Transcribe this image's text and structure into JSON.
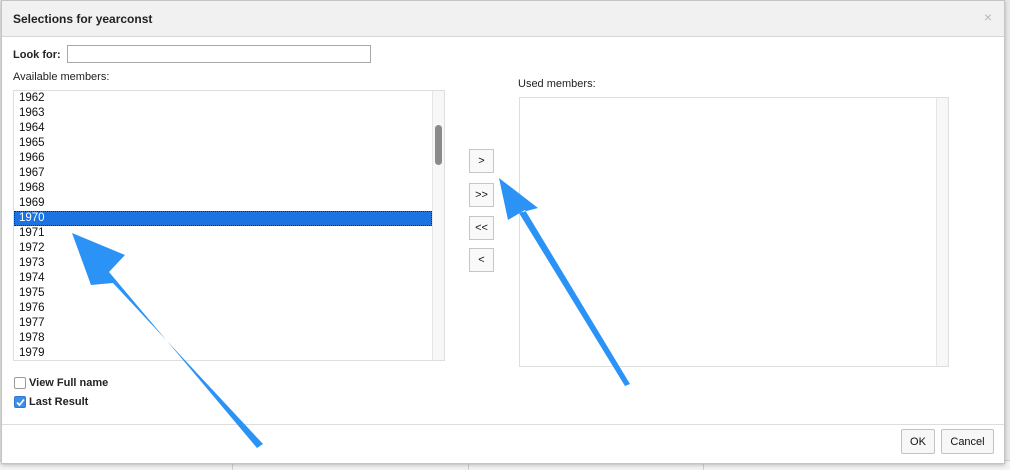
{
  "dialog": {
    "title": "Selections for yearconst",
    "close_glyph": "×",
    "look_for_label": "Look for:",
    "look_for_value": "",
    "available_label": "Available members:",
    "used_label": "Used members:",
    "available_members": [
      "1962",
      "1963",
      "1964",
      "1965",
      "1966",
      "1967",
      "1968",
      "1969",
      "1970",
      "1971",
      "1972",
      "1973",
      "1974",
      "1975",
      "1976",
      "1977",
      "1978",
      "1979"
    ],
    "selected_member": "1970",
    "used_members": [],
    "move_buttons": {
      "add": ">",
      "add_all": ">>",
      "remove_all": "<<",
      "remove": "<"
    },
    "options": {
      "view_full_name_label": "View Full name",
      "view_full_name_checked": false,
      "last_result_label": "Last Result",
      "last_result_checked": true
    },
    "ok_label": "OK",
    "cancel_label": "Cancel"
  },
  "annotations": {
    "arrow_color": "#2b93f5"
  }
}
